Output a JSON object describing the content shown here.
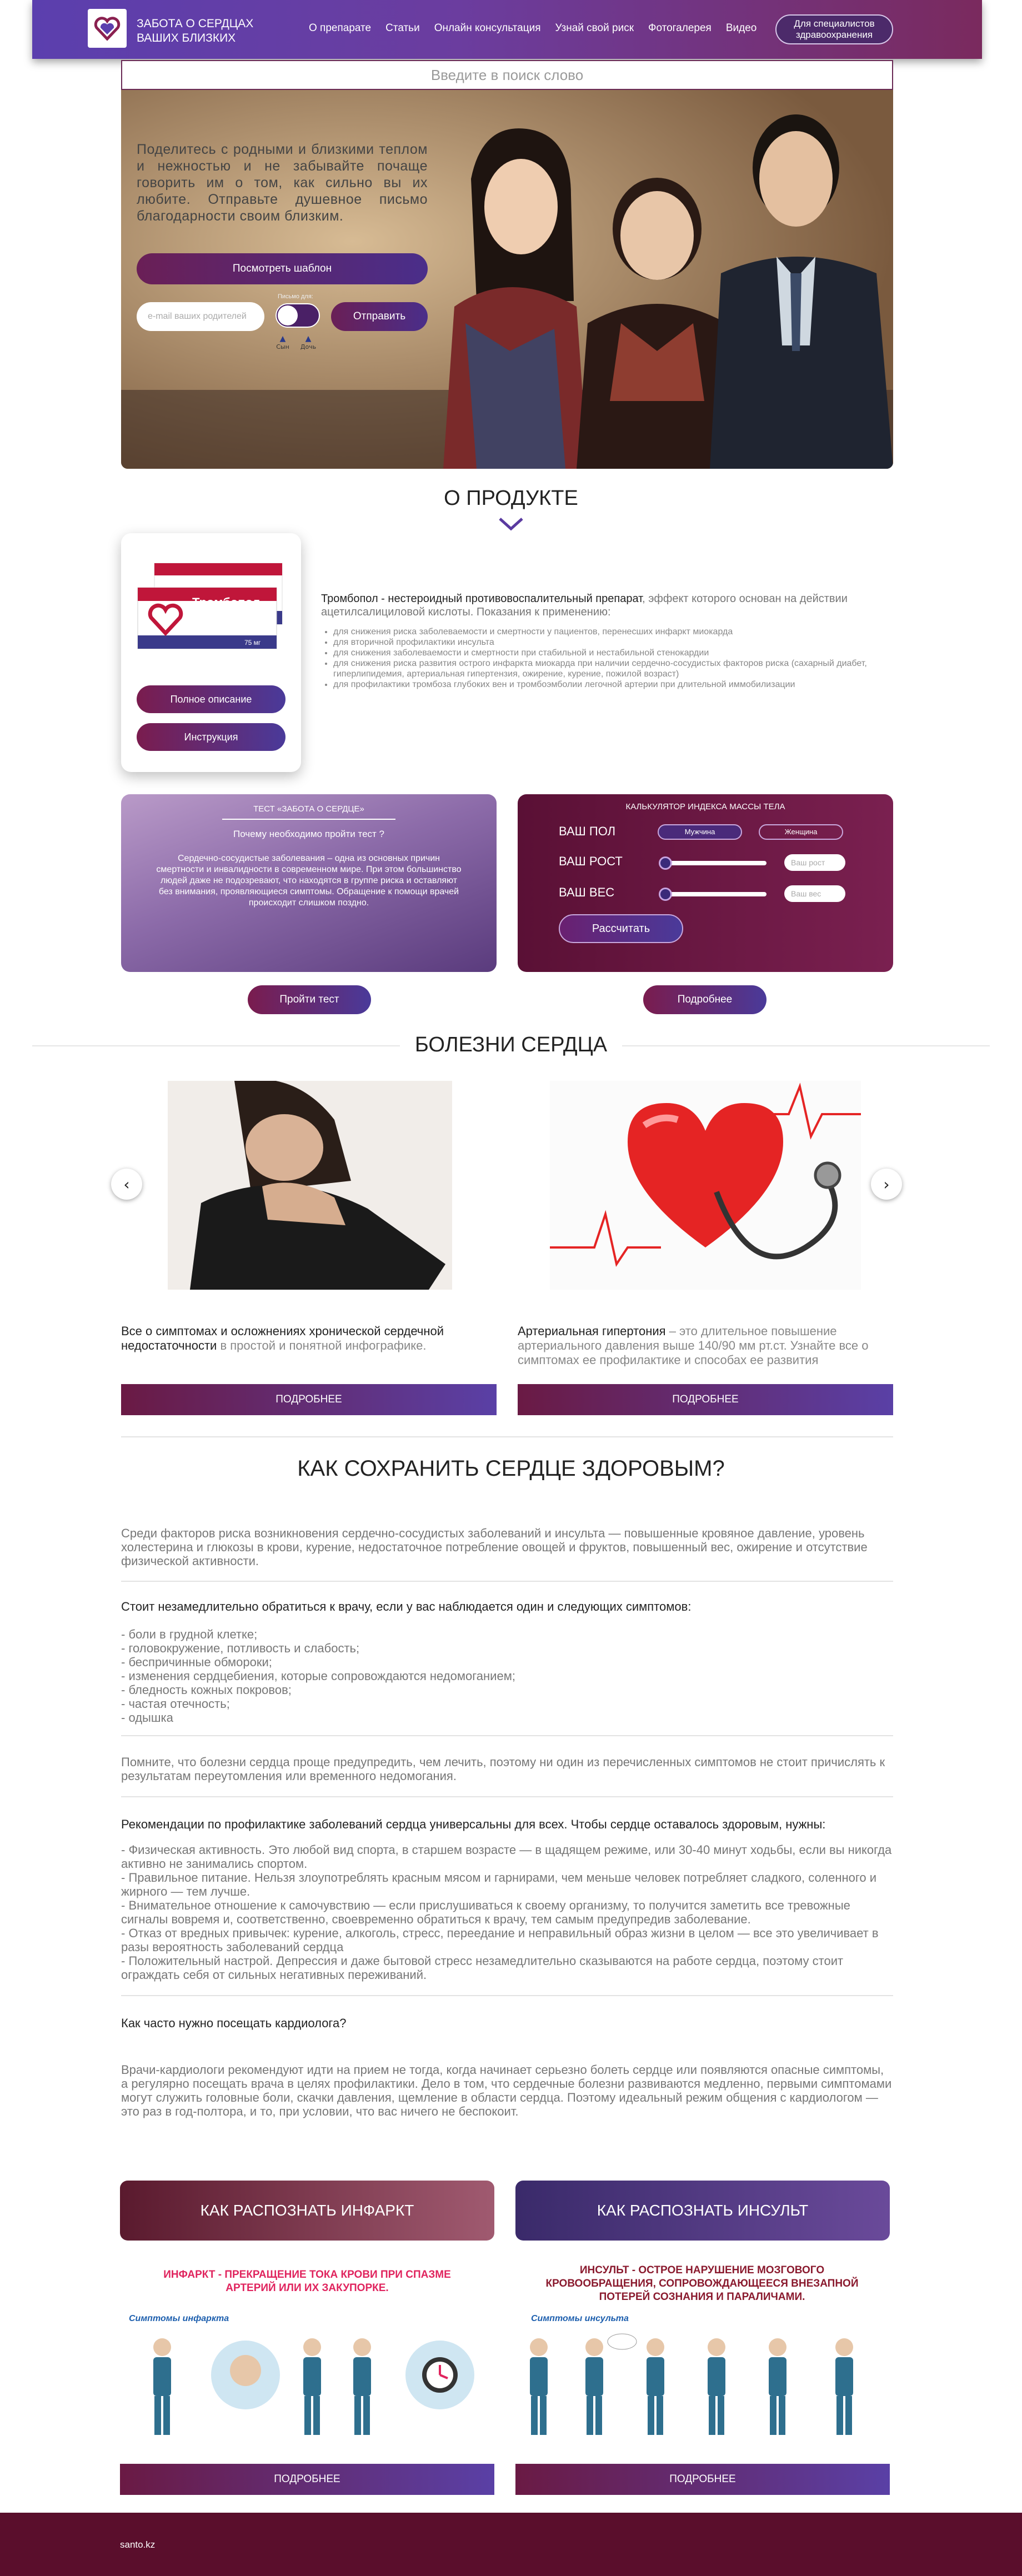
{
  "header": {
    "logo_text": "ЗАБОТА О СЕРДЦАХ ВАШИХ БЛИЗКИХ",
    "nav": [
      "О препарате",
      "Статьи",
      "Онлайн консультация",
      "Узнай свой риск",
      "Фотогалерея",
      "Видео"
    ],
    "spec_button": "Для специалистов здравоохранения"
  },
  "search": {
    "placeholder": "Введите в поиск слово"
  },
  "hero": {
    "text": "Поделитесь с родными и близкими теплом и нежностью и не забывайте почаще говорить им о том, как сильно вы их любите. Отправьте душевное письмо благодарности своим близким.",
    "template_button": "Посмотреть шаблон",
    "email_placeholder": "e-mail ваших родителей",
    "toggle_label": "Письмо для:",
    "gender_left": "Сын",
    "gender_right": "Дочь",
    "send_button": "Отправить"
  },
  "product": {
    "section_title": "О ПРОДУКТЕ",
    "package_name": "Тромбопол",
    "package_sub": "75 мг",
    "btn_description": "Полное описание",
    "btn_instruction": "Инструкция",
    "desc_bold": "Тромбопол - нестероидный противовоспалительный препарат",
    "desc_rest": ", эффект которого основан на действии ацетилсалициловой кислоты. Показания к применению:",
    "list": [
      "для снижения риска заболеваемости и смертности у пациентов, перенесших инфаркт миокарда",
      "для вторичной профилактики инсульта",
      "для снижения заболеваемости и смертности при стабильной и нестабильной стенокардии",
      "для снижения риска развития острого инфаркта миокарда при наличии сердечно-сосудистых факторов риска (сахарный диабет, гиперлипидемия, артериальная гипертензия, ожирение, курение, пожилой возраст)",
      "для профилактики тромбоза глубоких вен и тромбоэмболии легочной артерии при длительной иммобилизации"
    ]
  },
  "test": {
    "title": "ТЕСТ «ЗАБОТА О СЕРДЦЕ»",
    "question": "Почему необходимо пройти тест ?",
    "text": "Сердечно-сосудистые заболевания – одна из основных причин смертности и инвалидности в современном мире. При этом большинство людей даже не подозревают, что находятся в группе риска и оставляют без внимания, проявляющиеся симптомы. Обращение к помощи врачей происходит слишком поздно.",
    "button": "Пройти тест"
  },
  "bmi": {
    "title": "КАЛЬКУЛЯТОР ИНДЕКСА МАССЫ ТЕЛА",
    "gender_label": "ВАШ ПОЛ",
    "male": "Мужчина",
    "female": "Женщина",
    "height_label": "ВАШ РОСТ",
    "height_placeholder": "Ваш рост",
    "weight_label": "ВАШ ВЕС",
    "weight_placeholder": "Ваш вес",
    "calc_button": "Рассчитать",
    "more_button": "Подробнее"
  },
  "diseases": {
    "section_title": "БОЛЕЗНИ СЕРДЦА",
    "cards": [
      {
        "title_bold": "Все о симптомах и осложнениях хронической сердечной недостаточности",
        "title_rest": " в простой и понятной инфографике.",
        "button": "ПОДРОБНЕЕ"
      },
      {
        "title_bold": "Артериальная гипертония",
        "title_rest": " – это длительное повышение артериального давления выше 140/90 мм рт.ст. Узнайте все о симптомах ее профилактике и способах ее развития",
        "button": "ПОДРОБНЕЕ"
      }
    ]
  },
  "article": {
    "title": "КАК СОХРАНИТЬ СЕРДЦЕ ЗДОРОВЫМ?",
    "p1": "Среди факторов риска возникновения сердечно-сосудистых заболеваний и инсульта — повышенные кровяное давление, уровень холестерина и глюкозы в крови, курение, недостаточное потребление овощей и фруктов, повышенный вес, ожирение и отсутствие физической активности.",
    "h2": "Стоит незамедлительно обратиться к врачу, если у вас наблюдается один и следующих симптомов:",
    "symptoms": [
      "- боли в грудной клетке;",
      "- головокружение, потливость и слабость;",
      "- беспричинные обмороки;",
      "- изменения сердцебиения, которые сопровождаются недомоганием;",
      "- бледность кожных покровов;",
      "- частая отечность;",
      "- одышка"
    ],
    "p2": "Помните, что болезни сердца проще предупредить, чем лечить, поэтому ни один из перечисленных симптомов не стоит причислять к результатам переутомления или временного недомогания.",
    "h3": "Рекомендации по профилактике заболеваний сердца универсальны для всех. Чтобы сердце оставалось здоровым, нужны:",
    "recs": [
      "- Физическая активность. Это любой вид спорта, в старшем возрасте — в щадящем режиме, или 30-40 минут ходьбы, если вы никогда активно не занимались спортом.",
      "- Правильное питание. Нельзя злоупотреблять красным мясом и гарнирами, чем меньше человек потребляет сладкого, соленного и жирного — тем лучше.",
      "- Внимательное отношение к самочувствию — если прислушиваться к своему организму, то получится заметить все тревожные сигналы вовремя и, соответственно, своевременно обратиться к врачу, тем самым предупредив заболевание.",
      "- Отказ от вредных привычек: курение, алкоголь, стресс, переедание и неправильный образ жизни в целом — все это увеличивает в разы вероятность заболеваний сердца",
      "- Положительный настрой. Депрессия и даже бытовой стресс незамедлительно сказываются на работе сердца, поэтому стоит ограждать себя от сильных негативных переживаний."
    ],
    "h4": "Как часто нужно посещать кардиолога?",
    "p3": "Врачи-кардиологи рекомендуют идти на прием не тогда, когда начинает серьезно болеть сердце или появляются опасные симптомы, а регулярно посещать врача в целях профилактики. Дело в том, что сердечные болезни развиваются медленно, первыми симптомами могут служить головные боли, скачки давления, щемление в области сердца. Поэтому идеальный режим общения с кардиологом — это раз в год-полтора, и то, при условии, что вас ничего не беспокоит."
  },
  "recognize": [
    {
      "title": "КАК РАСПОЗНАТЬ ИНФАРКТ",
      "info_title": "ИНФАРКТ - ПРЕКРАЩЕНИЕ ТОКА КРОВИ ПРИ СПАЗМЕ АРТЕРИЙ ИЛИ ИХ ЗАКУПОРКЕ.",
      "sym": "Симптомы инфаркта",
      "button": "ПОДРОБНЕЕ",
      "color": "#7c2a44"
    },
    {
      "title": "КАК РАСПОЗНАТЬ ИНСУЛЬТ",
      "info_title": "ИНСУЛЬТ - ОСТРОЕ НАРУШЕНИЕ МОЗГОВОГО КРОВООБРАЩЕНИЯ, СОПРОВОЖДАЮЩЕЕСЯ ВНЕЗАПНОЙ ПОТЕРЕЙ СОЗНАНИЯ И ПАРАЛИЧАМИ.",
      "sym": "Симптомы инсульта",
      "button": "ПОДРОБНЕЕ",
      "color": "#4a3a9a"
    }
  ],
  "footer": {
    "site": "santo.kz"
  }
}
